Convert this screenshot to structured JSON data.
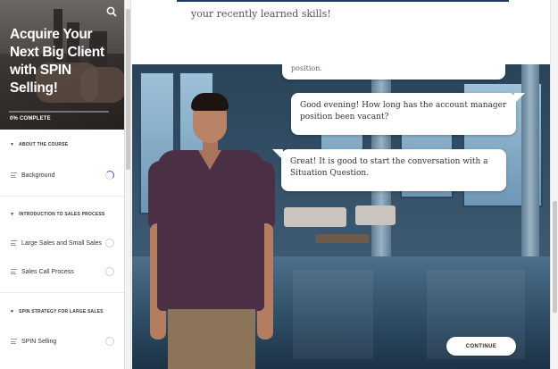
{
  "sidebar": {
    "course_title": "Acquire Your Next Big Client with SPIN Selling!",
    "progress_label": "0% COMPLETE",
    "progress_fraction": 0.0,
    "search_icon": "search-icon",
    "sections": [
      {
        "title": "ABOUT THE COURSE",
        "lessons": [
          {
            "label": "Background",
            "status": "in-progress"
          }
        ]
      },
      {
        "title": "INTRODUCTION TO SALES PROCESS",
        "lessons": [
          {
            "label": "Large Sales and Small Sales",
            "status": "not-started"
          },
          {
            "label": "Sales Call Process",
            "status": "not-started"
          }
        ]
      },
      {
        "title": "SPIN STRATEGY FOR LARGE SALES",
        "lessons": [
          {
            "label": "SPIN Selling",
            "status": "not-started"
          }
        ]
      }
    ]
  },
  "main": {
    "intro_text": "your recently learned skills!",
    "previous_bubble": "position.",
    "user_bubble": "Good evening! How long has the account manager position been vacant?",
    "avatar_bubble": "Great! It is good to start the conversation with a Situation Question.",
    "continue_label": "CONTINUE"
  },
  "colors": {
    "accent": "#1f3a6b",
    "progress_active": "#2d5fa8",
    "shirt": "#4b2f45"
  }
}
